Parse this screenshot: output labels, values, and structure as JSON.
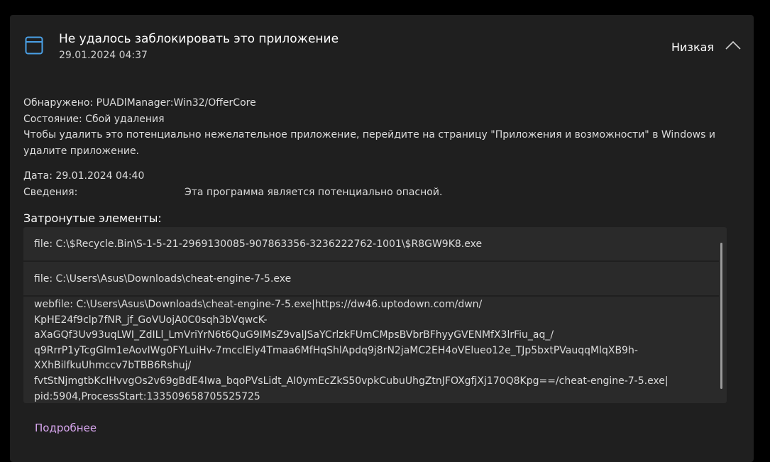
{
  "header": {
    "title": "Не удалось заблокировать это приложение",
    "timestamp": "29.01.2024 04:37",
    "severity": "Низкая",
    "app_icon": "app-window-icon",
    "collapse_icon": "chevron-up-icon"
  },
  "detection": {
    "detected_label": "Обнаружено:",
    "detected_value": "PUADlManager:Win32/OfferCore",
    "state_label": "Состояние:",
    "state_value": "Сбой удаления",
    "description": "Чтобы удалить это потенциально нежелательное приложение, перейдите на страницу \"Приложения и возможности\" в Windows и удалите приложение.",
    "date_label": "Дата:",
    "date_value": "29.01.2024 04:40",
    "details_label": "Сведения:",
    "details_value": "Эта программа является потенциально опасной."
  },
  "affected": {
    "title": "Затронутые элементы:",
    "items": [
      "file: C:\\$Recycle.Bin\\S-1-5-21-2969130085-907863356-3236222762-1001\\$R8GW9K8.exe",
      "file: C:\\Users\\Asus\\Downloads\\cheat-engine-7-5.exe"
    ],
    "webfile_lines": [
      "webfile: C:\\Users\\Asus\\Downloads\\cheat-engine-7-5.exe|https://dw46.uptodown.com/dwn/",
      "KpHE24f9clp7fNR_jf_GoVUojA0C0sqh3bVqwcK-",
      "aXaGQf3Uv93uqLWI_ZdILl_LmVriYrN6t6QuG9IMsZ9valJSaYCrlzkFUmCMpsBVbrBFhyyGVENMfX3lrFiu_aq_/",
      "q9RrrP1yTcgGIm1eAovIWg0FYLuiHv-7mcclEly4Tmaa6MfHqShlApdq9j8rN2jaMC2EH4oVElueo12e_TJp5bxtPVauqqMlqXB9h-",
      "XXhBilfkuUhmccv7bTBB6Rshuj/",
      "fvtStNjmgtbKcIHvvgOs2v69gBdE4Iwa_bqoPVsLidt_AI0ymEcZkS50vpkCubuUhgZtnJFOXgfjXj170Q8Kpg==/cheat-engine-7-5.exe|",
      "pid:5904,ProcessStart:133509658705525725"
    ]
  },
  "footer": {
    "more_link": "Подробнее"
  },
  "colors": {
    "background": "#000000",
    "card": "#1f1f1f",
    "items_box": "#2a2a2a",
    "link": "#d9a7f0",
    "icon_accent": "#4aa0e6"
  }
}
